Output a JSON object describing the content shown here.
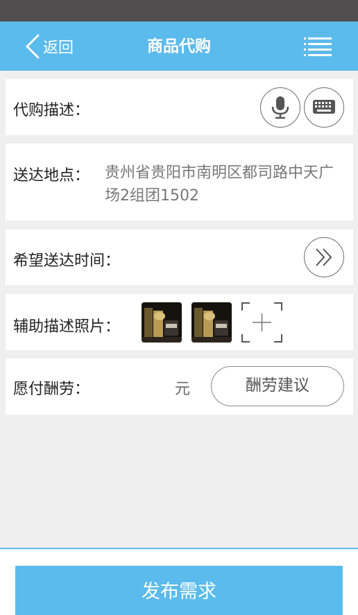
{
  "header": {
    "back_label": "返回",
    "title": "商品代购",
    "back_icon": "chevron-left-icon",
    "menu_icon": "list-menu-icon"
  },
  "form": {
    "description_label": "代购描述：",
    "voice_icon": "microphone-icon",
    "keyboard_icon": "keyboard-icon",
    "address_label": "送达地点：",
    "address_value": "贵州省贵阳市南明区都司路中天广场2组团1502",
    "time_label": "希望送达时间：",
    "time_icon": "double-chevron-right-icon",
    "photos_label": "辅助描述照片：",
    "add_photo_icon": "add-photo-icon",
    "reward_label": "愿付酬劳：",
    "reward_unit": "元",
    "reward_suggest_label": "酬劳建议"
  },
  "footer": {
    "submit_label": "发布需求"
  },
  "colors": {
    "accent": "#5bbbec",
    "status_bar": "#504d4e",
    "background": "#efefef"
  }
}
